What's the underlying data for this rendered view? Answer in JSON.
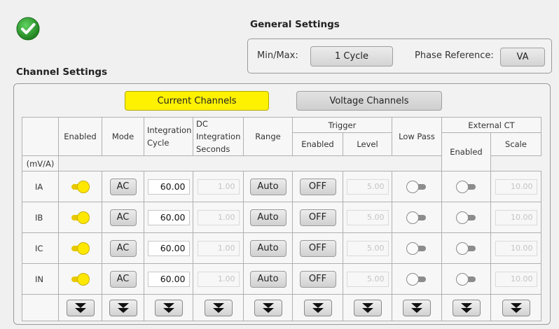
{
  "status": {
    "icon": "check-circle-icon",
    "color": "#2e9a2e"
  },
  "general_settings": {
    "title": "General Settings",
    "minmax_label": "Min/Max:",
    "minmax_value": "1 Cycle",
    "phase_label": "Phase Reference:",
    "phase_value": "VA"
  },
  "channel_settings": {
    "title": "Channel Settings",
    "tabs": [
      {
        "label": "Current Channels",
        "active": true,
        "color": "#fff200"
      },
      {
        "label": "Voltage Channels",
        "active": false
      }
    ],
    "headers": {
      "enabled": "Enabled",
      "mode": "Mode",
      "integration_cycle": "Integration Cycle",
      "dc_integration_seconds": "DC Integration Seconds",
      "range": "Range",
      "trigger": "Trigger",
      "trigger_enabled": "Enabled",
      "trigger_level": "Level",
      "low_pass": "Low Pass",
      "external_ct": "External CT",
      "ext_enabled": "Enabled",
      "ext_scale": "Scale",
      "ext_scale_unit": "(mV/A)"
    },
    "rows": [
      {
        "name": "IA",
        "enabled": true,
        "mode": "AC",
        "integration_cycle": "60.00",
        "dc_seconds": "1.00",
        "range": "Auto",
        "trigger_enabled": "OFF",
        "trigger_level": "5.00",
        "low_pass": false,
        "ext_enabled": false,
        "ext_scale": "10.00"
      },
      {
        "name": "IB",
        "enabled": true,
        "mode": "AC",
        "integration_cycle": "60.00",
        "dc_seconds": "1.00",
        "range": "Auto",
        "trigger_enabled": "OFF",
        "trigger_level": "5.00",
        "low_pass": false,
        "ext_enabled": false,
        "ext_scale": "10.00"
      },
      {
        "name": "IC",
        "enabled": true,
        "mode": "AC",
        "integration_cycle": "60.00",
        "dc_seconds": "1.00",
        "range": "Auto",
        "trigger_enabled": "OFF",
        "trigger_level": "5.00",
        "low_pass": false,
        "ext_enabled": false,
        "ext_scale": "10.00"
      },
      {
        "name": "IN",
        "enabled": true,
        "mode": "AC",
        "integration_cycle": "60.00",
        "dc_seconds": "1.00",
        "range": "Auto",
        "trigger_enabled": "OFF",
        "trigger_level": "5.00",
        "low_pass": false,
        "ext_enabled": false,
        "ext_scale": "10.00"
      }
    ],
    "fill_down_icon": "double-chevron-down-icon"
  }
}
